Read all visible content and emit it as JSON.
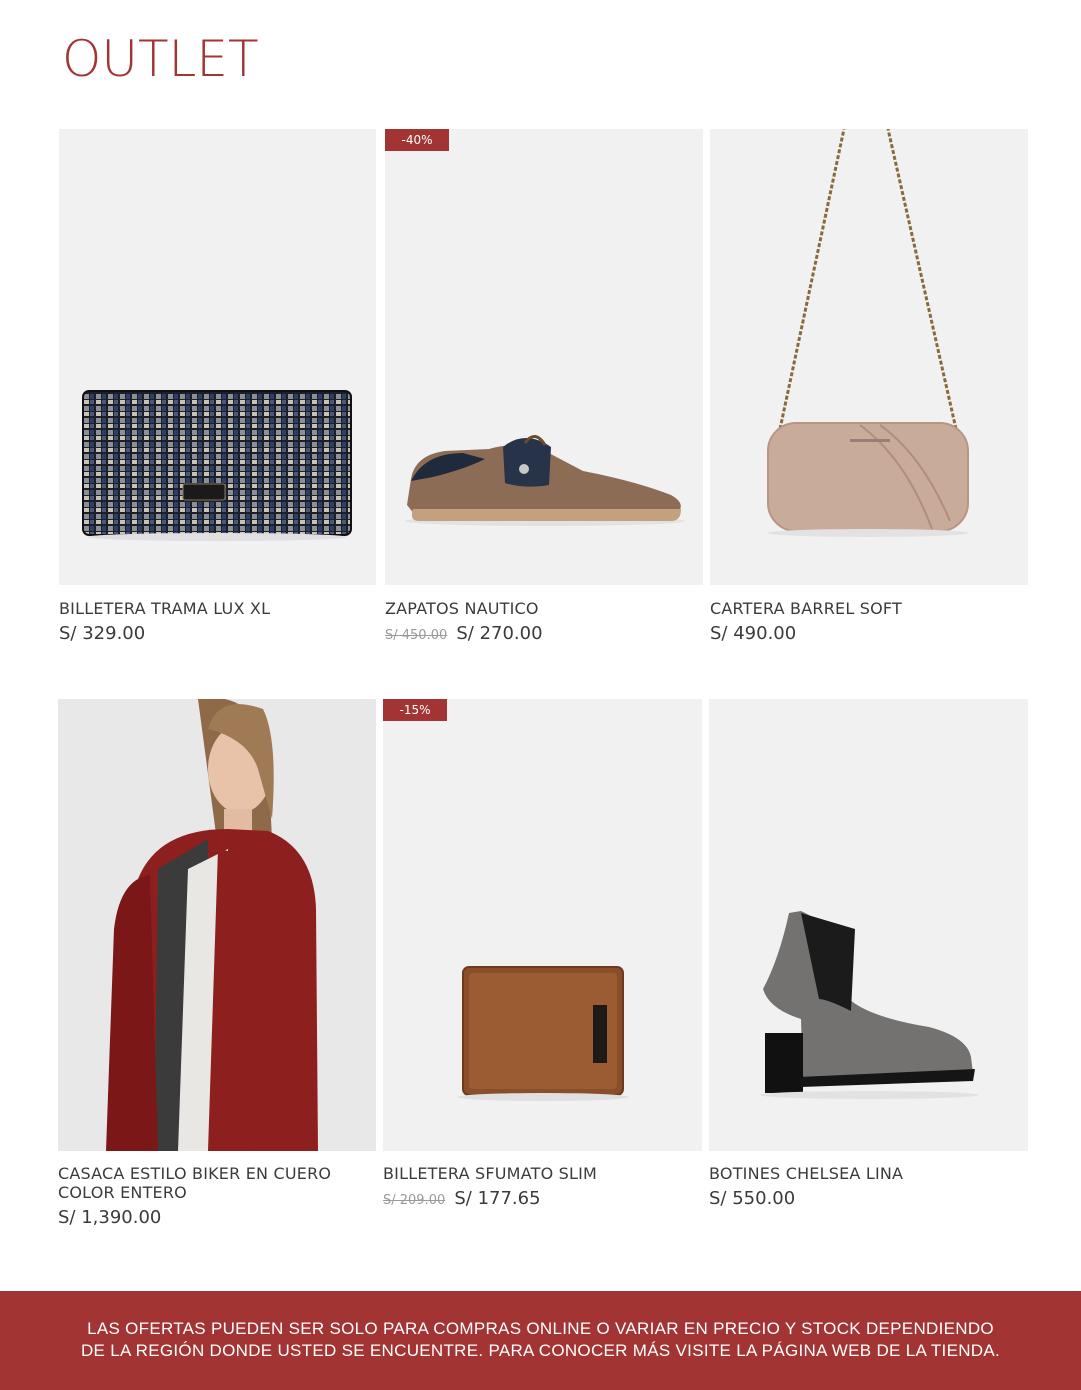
{
  "page": {
    "title": "OUTLET"
  },
  "products": [
    {
      "name": "BILLETERA TRAMA LUX XL",
      "old_price": "",
      "price": "S/ 329.00",
      "badge": "",
      "image": "woven-wallet-image"
    },
    {
      "name": "ZAPATOS NAUTICO",
      "old_price": "S/ 450.00",
      "price": "S/ 270.00",
      "badge": "-40%",
      "image": "boat-shoe-image"
    },
    {
      "name": "CARTERA BARREL SOFT",
      "old_price": "",
      "price": "S/ 490.00",
      "badge": "",
      "image": "barrel-bag-image"
    },
    {
      "name": "CASACA ESTILO BIKER EN CUERO COLOR ENTERO",
      "old_price": "",
      "price": "S/ 1,390.00",
      "badge": "",
      "image": "leather-jacket-image"
    },
    {
      "name": "BILLETERA SFUMATO SLIM",
      "old_price": "S/ 209.00",
      "price": "S/ 177.65",
      "badge": "-15%",
      "image": "slim-wallet-image"
    },
    {
      "name": "BOTINES CHELSEA LINA",
      "old_price": "",
      "price": "S/ 550.00",
      "badge": "",
      "image": "chelsea-boot-image"
    }
  ],
  "footer": {
    "line1": "LAS OFERTAS PUEDEN SER SOLO PARA COMPRAS ONLINE O VARIAR EN PRECIO Y STOCK DEPENDIENDO",
    "line2": "DE LA REGIÓN DONDE USTED SE ENCUENTRE. PARA CONOCER MÁS VISITE LA PÁGINA WEB DE LA TIENDA."
  },
  "colors": {
    "accent": "#a33434",
    "image_bg": "#f1f1f1",
    "text": "#3b3b3b",
    "muted": "#9a9a9a"
  }
}
